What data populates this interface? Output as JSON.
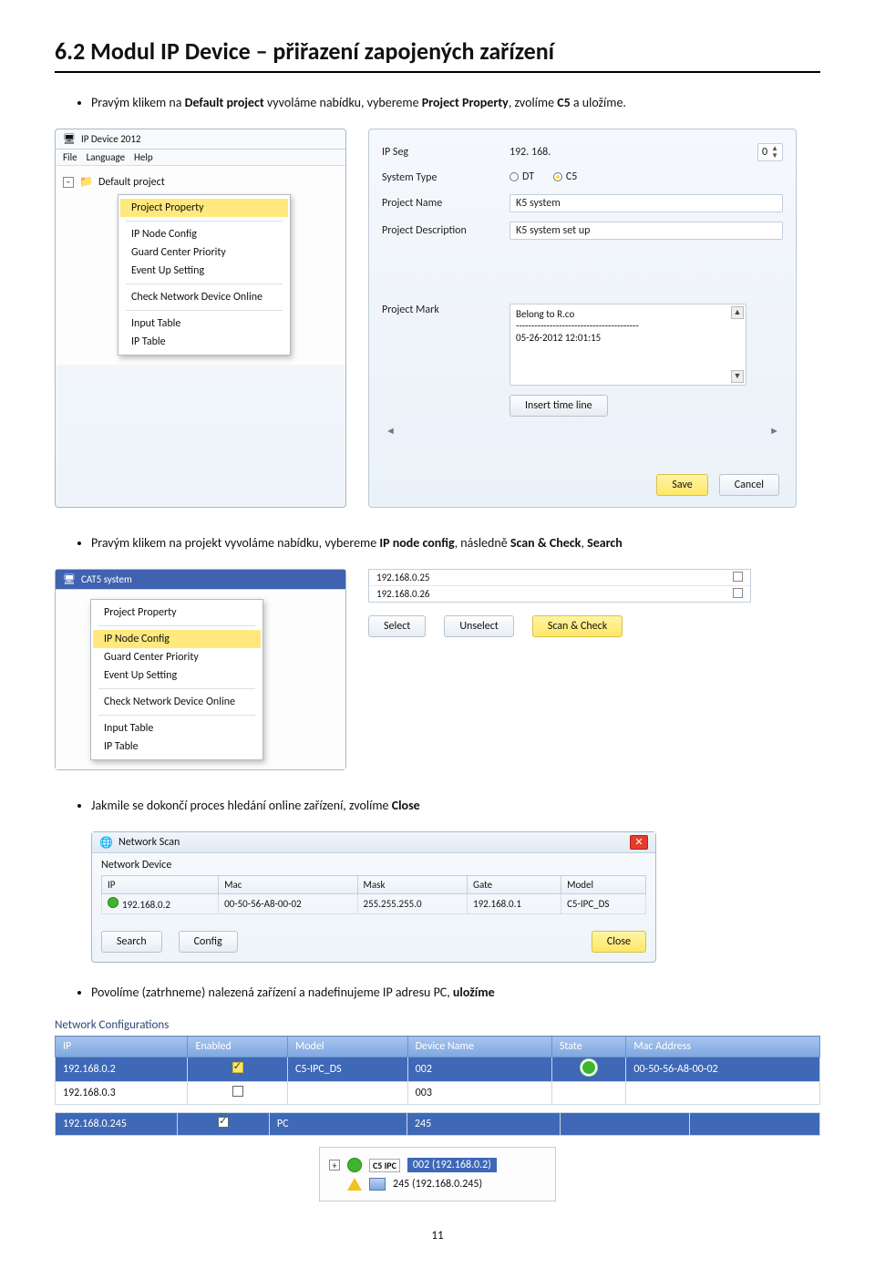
{
  "heading": "6.2 Modul IP Device – přiřazení zapojených zařízení",
  "bullet1": {
    "prefix": "Pravým klikem na ",
    "b1": "Default project",
    "mid": " vyvoláme nabídku, vybereme ",
    "b2": "Project Property",
    ", zvolíme ": ", zvolíme ",
    "b3": "C5",
    "tail": " a uložíme."
  },
  "bullet1_tail_text": " a uložíme.",
  "bullet1_mid2": ", zvolíme ",
  "win1": {
    "title": "IP Device 2012",
    "menus": [
      "File",
      "Language",
      "Help"
    ],
    "root": "Default project",
    "menu": [
      "Project Property",
      "IP Node Config",
      "Guard Center Priority",
      "Event Up Setting",
      "Check Network Device Online",
      "Input Table",
      "IP Table"
    ]
  },
  "panel1": {
    "seg_lbl": "IP Seg",
    "seg_val": "192. 168.",
    "seg_spin": "0",
    "type_lbl": "System Type",
    "opt_dt": "DT",
    "opt_c5": "C5",
    "name_lbl": "Project Name",
    "name_val": "K5 system",
    "desc_lbl": "Project Description",
    "desc_val": "K5 system set up",
    "mark_lbl": "Project Mark",
    "mark_val": "Belong to R.co\n----------------------------------------\n05-26-2012 12:01:15",
    "insert_btn": "Insert time line",
    "save": "Save",
    "cancel": "Cancel"
  },
  "bullet2": {
    "prefix": "Pravým klikem na projekt vyvoláme nabídku, vybereme ",
    "b1": "IP node config",
    "mid": ", následně ",
    "b2": "Scan & Check",
    "b3": "Search"
  },
  "win2": {
    "title": "CAT5 system",
    "menu": [
      "Project Property",
      "IP Node Config",
      "Guard Center Priority",
      "Event Up Setting",
      "Check Network Device Online",
      "Input Table",
      "IP Table"
    ]
  },
  "iplist": {
    "ips": [
      "192.168.0.25",
      "192.168.0.26"
    ],
    "select": "Select",
    "unselect": "Unselect",
    "scan": "Scan & Check"
  },
  "bullet3": {
    "prefix": "Jakmile se dokončí proces hledání online zařízení, zvolíme ",
    "b1": "Close"
  },
  "scan": {
    "title": "Network Scan",
    "sub": "Network Device",
    "cols": [
      "IP",
      "Mac",
      "Mask",
      "Gate",
      "Model"
    ],
    "row": [
      "192.168.0.2",
      "00-50-56-A8-00-02",
      "255.255.255.0",
      "192.168.0.1",
      "C5-IPC_DS"
    ],
    "search": "Search",
    "config": "Config",
    "close": "Close"
  },
  "bullet4": {
    "prefix": "Povolíme (zatrhneme) nalezená zařízení a nadefinujeme IP adresu PC, ",
    "b1": "uložíme"
  },
  "netcfg": {
    "head": "Network Configurations",
    "cols": [
      "IP",
      "Enabled",
      "Model",
      "Device Name",
      "State",
      "Mac Address"
    ],
    "r1": [
      "192.168.0.2",
      "",
      "C5-IPC_DS",
      "002",
      "",
      "00-50-56-A8-00-02"
    ],
    "r2": [
      "192.168.0.3",
      "",
      "",
      "003",
      "",
      ""
    ],
    "r3": [
      "192.168.0.245",
      "",
      "PC",
      "245",
      "",
      ""
    ]
  },
  "tree": {
    "badge": "C5 IPC",
    "n1": "002 (192.168.0.2)",
    "n2": "245 (192.168.0.245)"
  },
  "page": "11"
}
